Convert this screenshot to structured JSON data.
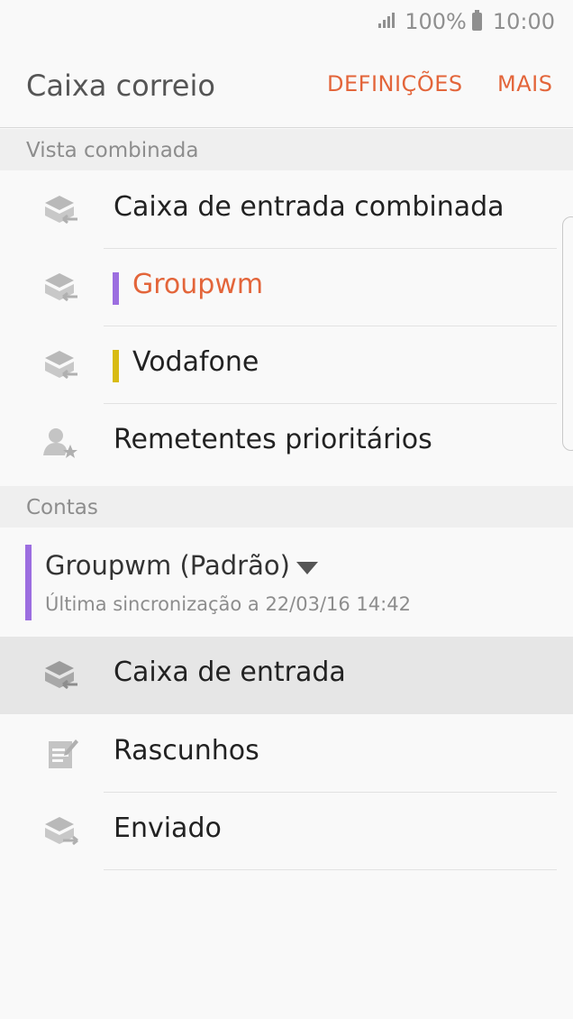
{
  "status_bar": {
    "battery": "100%",
    "time": "10:00"
  },
  "header": {
    "title": "Caixa correio",
    "settings_label": "DEFINIÇÕES",
    "more_label": "MAIS"
  },
  "sections": {
    "combined": "Vista combinada",
    "accounts": "Contas"
  },
  "combined_items": [
    {
      "label": "Caixa de entrada combinada"
    },
    {
      "label": "Groupwm",
      "color": "#9c6ee0",
      "text_color": "#e3653a"
    },
    {
      "label": "Vodafone",
      "color": "#d8bb12"
    },
    {
      "label": "Remetentes prioritários"
    }
  ],
  "account": {
    "name": "Groupwm (Padrão)",
    "sync": "Última sincronização a 22/03/16 14:42",
    "color": "#9c6ee0"
  },
  "folders": [
    {
      "label": "Caixa de entrada",
      "selected": true
    },
    {
      "label": "Rascunhos"
    },
    {
      "label": "Enviado"
    }
  ],
  "colors": {
    "accent": "#e3653a",
    "icon": "#b9b9b9"
  }
}
